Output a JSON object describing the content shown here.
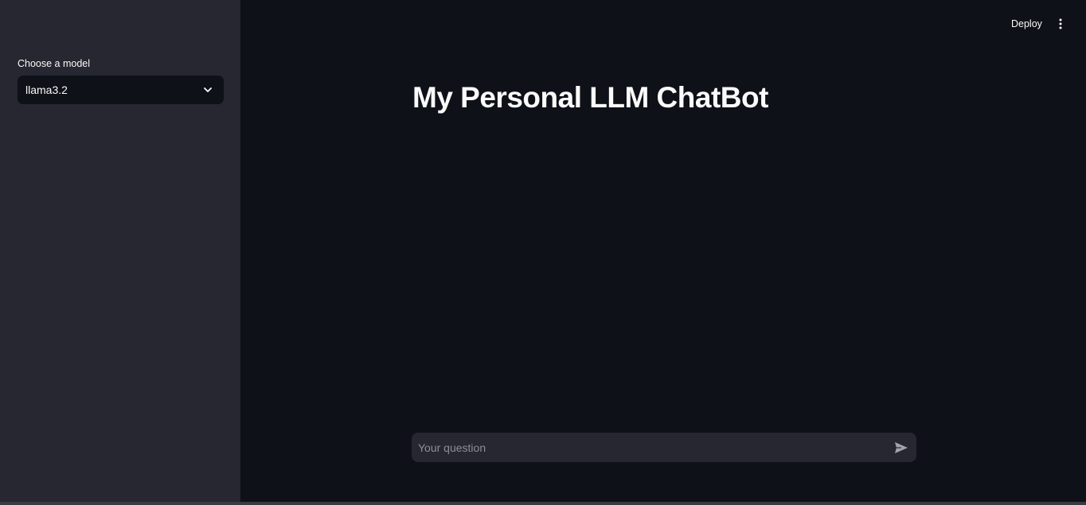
{
  "sidebar": {
    "model_label": "Choose a model",
    "model_select": {
      "value": "llama3.2",
      "icon": "chevron-down-icon"
    }
  },
  "header": {
    "deploy_label": "Deploy",
    "menu_icon": "kebab-menu-icon"
  },
  "main": {
    "title": "My Personal LLM ChatBot",
    "chat_input": {
      "placeholder": "Your question",
      "value": "",
      "send_icon": "send-icon"
    }
  },
  "colors": {
    "main_background": "#0e1117",
    "sidebar_background": "#262730",
    "input_background": "#262730",
    "text": "#fafafa",
    "placeholder": "#8d8e95"
  }
}
